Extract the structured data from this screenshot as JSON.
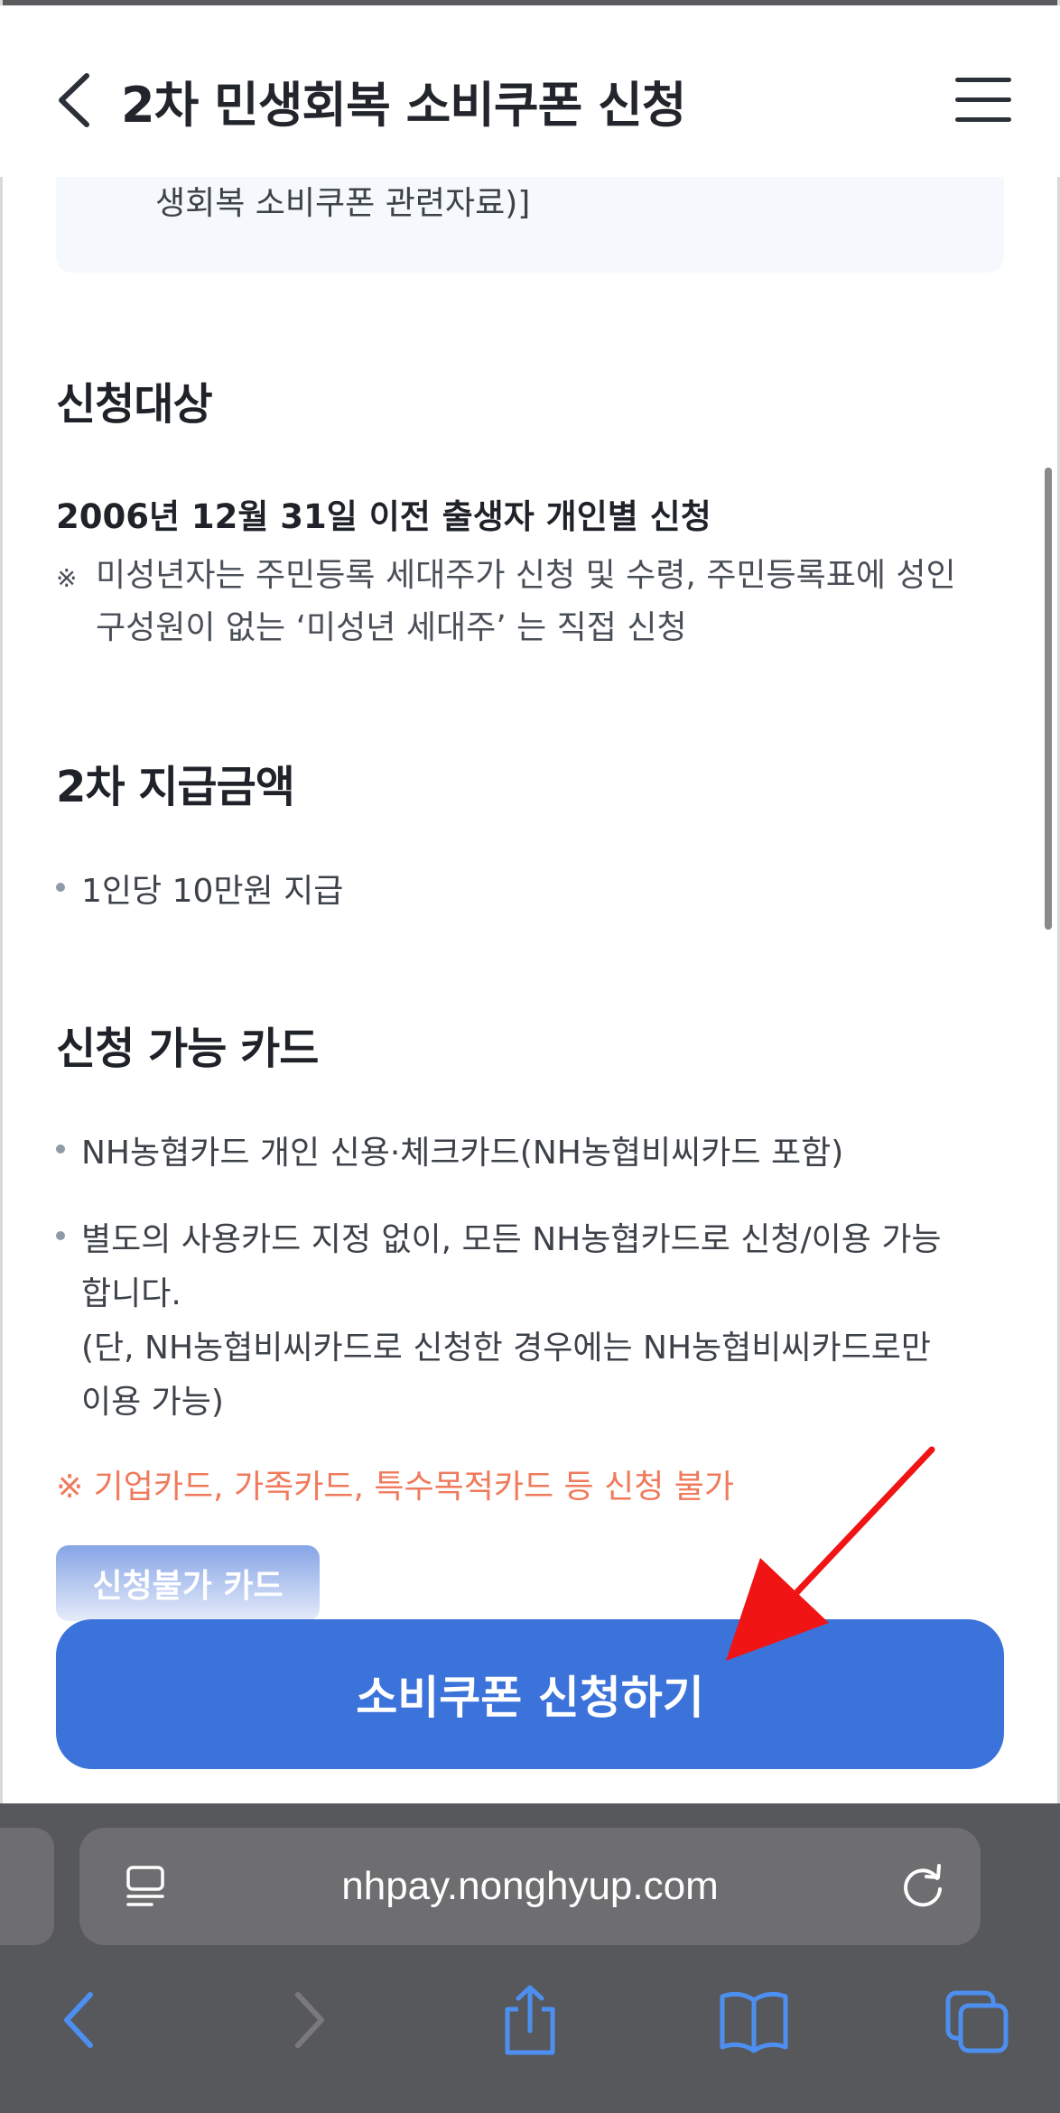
{
  "header": {
    "title": "2차 민생회복 소비쿠폰 신청"
  },
  "infobox": {
    "text": "생회복 소비쿠폰 관련자료)]"
  },
  "section_target": {
    "heading": "신청대상",
    "strong": "2006년 12월 31일 이전 출생자 개인별 신청",
    "note_mark": "※",
    "note_line1": "미성년자는 주민등록 세대주가 신청 및 수령, 주민등록표에 성인",
    "note_line2": "구성원이 없는 ‘미성년 세대주’ 는 직접 신청"
  },
  "section_amount": {
    "heading": "2차 지급금액",
    "bullet": "1인당 10만원 지급"
  },
  "section_cards": {
    "heading": "신청 가능 카드",
    "bullet1": "NH농협카드 개인 신용·체크카드(NH농협비씨카드 포함)",
    "bullet2_line1": "별도의 사용카드 지정 없이, 모든 NH농협카드로 신청/이용 가능",
    "bullet2_line2": "합니다.",
    "bullet2_line3": "(단, NH농협비씨카드로 신청한 경우에는 NH농협비씨카드로만",
    "bullet2_line4": "이용 가능)",
    "warning": "※ 기업카드, 가족카드, 특수목적카드 등 신청 불가",
    "unavailable_button": "신청불가 카드"
  },
  "cta": {
    "label": "소비쿠폰 신청하기"
  },
  "browser": {
    "url": "nhpay.nonghyup.com"
  },
  "colors": {
    "primary": "#3c73da",
    "warning": "#f07a5c",
    "arrow": "#f01414",
    "toolbar_blue": "#4d8ff0"
  },
  "icons": [
    "back-chevron-icon",
    "menu-icon",
    "page-icon",
    "reload-icon",
    "back-icon",
    "forward-icon",
    "share-icon",
    "bookmarks-icon",
    "tabs-icon"
  ]
}
